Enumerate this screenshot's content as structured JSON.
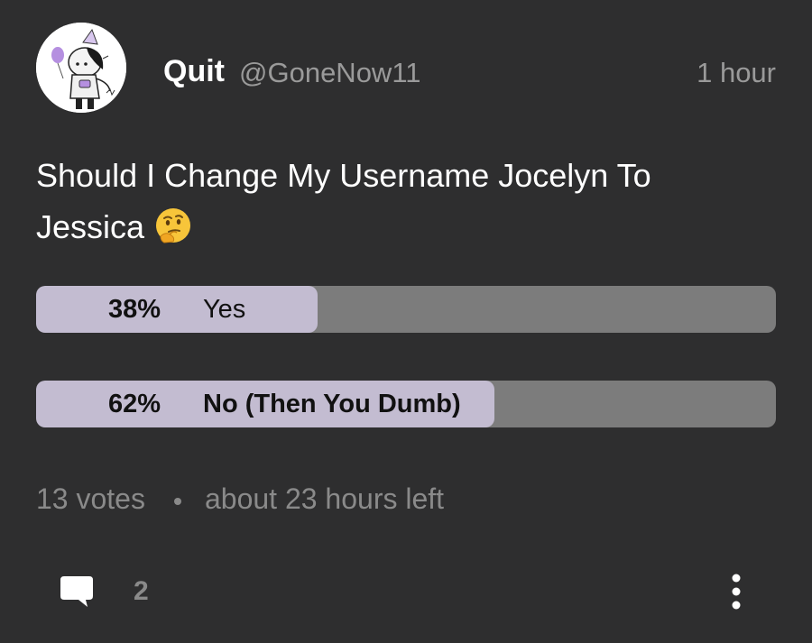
{
  "post": {
    "author": {
      "display_name": "Quit",
      "handle": "@GoneNow11",
      "avatar_icon": "avatar-drawing-icon"
    },
    "timestamp": "1 hour",
    "question": "Should I Change My Username Jocelyn To Jessica",
    "question_emoji": "thinking-face-icon"
  },
  "poll": {
    "options": [
      {
        "percent_label": "38%",
        "label": "Yes",
        "fraction": 0.38
      },
      {
        "percent_label": "62%",
        "label": "No (Then You Dumb)",
        "fraction": 0.62
      }
    ],
    "votes": "13 votes",
    "time_left": "about 23 hours left"
  },
  "actions": {
    "comment_icon": "comment-bubble-icon",
    "comment_count": "2",
    "more_icon": "more-vertical-icon"
  },
  "colors": {
    "background": "#2e2e2f",
    "poll_fill": "#c3bcd1",
    "poll_track": "#7c7c7c",
    "muted_text": "#8a8a8a"
  }
}
